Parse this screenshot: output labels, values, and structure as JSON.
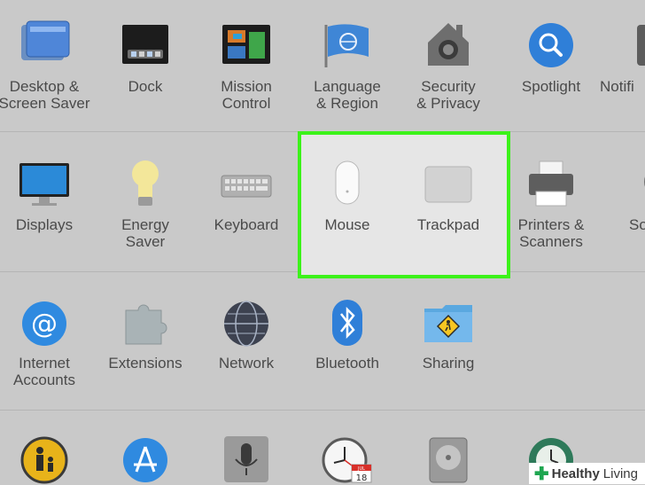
{
  "rows": {
    "personal": [
      {
        "lines": [
          "Desktop &",
          "Screen Saver"
        ],
        "icon": "desktop-screen-saver-icon"
      },
      {
        "lines": [
          "Dock"
        ],
        "icon": "dock-icon"
      },
      {
        "lines": [
          "Mission",
          "Control"
        ],
        "icon": "mission-control-icon"
      },
      {
        "lines": [
          "Language",
          "& Region"
        ],
        "icon": "language-region-icon"
      },
      {
        "lines": [
          "Security",
          "& Privacy"
        ],
        "icon": "security-privacy-icon"
      },
      {
        "lines": [
          "Spotlight"
        ],
        "icon": "spotlight-icon"
      },
      {
        "lines": [
          "Notifi"
        ],
        "icon": "notifications-icon"
      }
    ],
    "hardware": [
      {
        "lines": [
          "Displays"
        ],
        "icon": "displays-icon"
      },
      {
        "lines": [
          "Energy",
          "Saver"
        ],
        "icon": "energy-saver-icon"
      },
      {
        "lines": [
          "Keyboard"
        ],
        "icon": "keyboard-icon"
      },
      {
        "lines": [
          "Mouse"
        ],
        "icon": "mouse-icon"
      },
      {
        "lines": [
          "Trackpad"
        ],
        "icon": "trackpad-icon"
      },
      {
        "lines": [
          "Printers &",
          "Scanners"
        ],
        "icon": "printers-scanners-icon"
      },
      {
        "lines": [
          "So"
        ],
        "icon": "sound-icon"
      }
    ],
    "internet": [
      {
        "lines": [
          "Internet",
          "Accounts"
        ],
        "icon": "internet-accounts-icon"
      },
      {
        "lines": [
          "Extensions"
        ],
        "icon": "extensions-icon"
      },
      {
        "lines": [
          "Network"
        ],
        "icon": "network-icon"
      },
      {
        "lines": [
          "Bluetooth"
        ],
        "icon": "bluetooth-icon"
      },
      {
        "lines": [
          "Sharing"
        ],
        "icon": "sharing-icon"
      }
    ],
    "system": [
      {
        "icon": "parental-controls-icon"
      },
      {
        "icon": "app-store-icon"
      },
      {
        "icon": "dictation-speech-icon"
      },
      {
        "icon": "date-time-icon",
        "calendar_day": "18",
        "calendar_month": "JUL"
      },
      {
        "icon": "startup-disk-icon"
      },
      {
        "icon": "time-machine-icon"
      }
    ]
  },
  "highlight_color": "#3cf21a",
  "watermark": {
    "brand_bold": "Healthy",
    "brand_rest": "Living"
  }
}
